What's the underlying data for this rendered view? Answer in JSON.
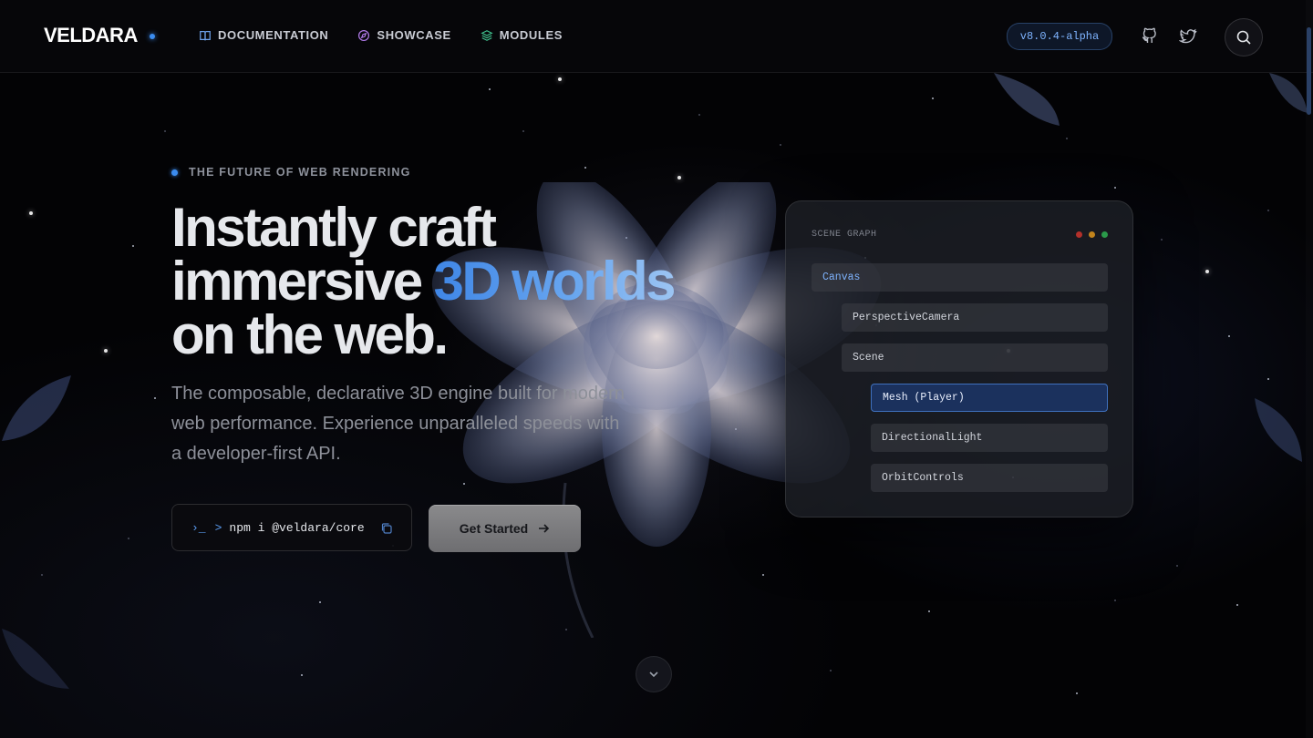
{
  "header": {
    "logo": "VELDARA",
    "nav": [
      {
        "label": "DOCUMENTATION",
        "icon": "book-icon"
      },
      {
        "label": "SHOWCASE",
        "icon": "compass-icon"
      },
      {
        "label": "MODULES",
        "icon": "layers-icon"
      }
    ],
    "version": "v8.0.4-alpha",
    "icons": [
      "github-icon",
      "twitter-icon",
      "search-icon"
    ]
  },
  "hero": {
    "eyebrow": "THE FUTURE OF WEB RENDERING",
    "headline_line1": "Instantly craft",
    "headline_line2_plain": "immersive ",
    "headline_line2_accent": "3D worlds",
    "headline_line3": "on the web.",
    "subtext": "The composable, declarative 3D engine built for modern web performance. Experience unparalleled speeds with a developer-first API.",
    "install": {
      "prompt": "›_",
      "caret": ">",
      "command": "npm i @veldara/core"
    },
    "cta_label": "Get Started"
  },
  "scene_graph": {
    "title": "SCENE GRAPH",
    "nodes": [
      {
        "label": "Canvas",
        "depth": 0
      },
      {
        "label": "PerspectiveCamera",
        "depth": 1
      },
      {
        "label": "Scene",
        "depth": 1
      },
      {
        "label": "Mesh (Player)",
        "depth": 2,
        "selected": true
      },
      {
        "label": "DirectionalLight",
        "depth": 2
      },
      {
        "label": "OrbitControls",
        "depth": 2
      }
    ]
  },
  "colors": {
    "accent": "#3b8cf0",
    "background": "#030305",
    "panel": "#1c1e24",
    "traffic_red": "#c0392b",
    "traffic_yellow": "#c98a1e",
    "traffic_green": "#2e9e4f"
  }
}
